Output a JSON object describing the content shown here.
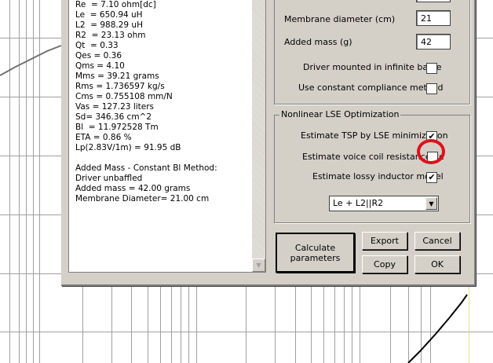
{
  "results": {
    "lines": [
      "Re  = 7.10 ohm[dc]",
      "Le  = 650.94 uH",
      "L2  = 988.29 uH",
      "R2  = 23.13 ohm",
      "Qt  = 0.33",
      "Qes = 0.36",
      "Qms = 4.10",
      "Mms = 39.21 grams",
      "Rms = 1.736597 kg/s",
      "Cms = 0.755108 mm/N",
      "Vas = 127.23 liters",
      "Sd= 346.36 cm^2",
      "Bl  = 11.972528 Tm",
      "ETA = 0.86 %",
      "Lp(2.83V/1m) = 91.95 dB",
      "",
      "Added Mass - Constant Bl Method:",
      "Driver unbaffled",
      "Added mass = 42.00 grams",
      "Membrane Diameter= 21.00 cm"
    ]
  },
  "added_mass": {
    "membrane_diameter_label": "Membrane diameter (cm)",
    "membrane_diameter_value": "21",
    "added_mass_label": "Added mass (g)",
    "added_mass_value": "42",
    "infinite_baffle_label": "Driver mounted in infinite baffle",
    "infinite_baffle_checked": false,
    "constant_compliance_label": "Use constant compliance method",
    "constant_compliance_checked": false
  },
  "lse": {
    "title": "Nonlinear LSE Optimization",
    "estimate_tsp_label": "Estimate TSP by LSE minimization",
    "estimate_tsp_checked": true,
    "estimate_re_label": "Estimate voice coil resistance Re",
    "estimate_re_checked": false,
    "estimate_lossy_label": "Estimate lossy inductor model",
    "estimate_lossy_checked": true,
    "model_selected": "Le + L2||R2"
  },
  "buttons": {
    "calculate": "Calculate parameters",
    "export": "Export",
    "cancel": "Cancel",
    "copy": "Copy",
    "ok": "OK"
  },
  "check_mark": "✔",
  "annotation_color": "#e0101a"
}
